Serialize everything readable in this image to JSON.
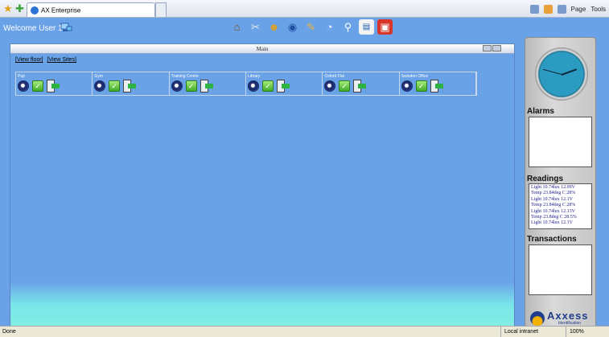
{
  "browser": {
    "tab_title": "AX Enterprise",
    "tools": {
      "page_label": "Page",
      "tools_label": "Tools"
    }
  },
  "app": {
    "welcome": "Welcome User 1",
    "toolbar_icons": [
      "home-icon",
      "tools-icon",
      "users-icon",
      "globe-icon",
      "report-icon",
      "clock-icon",
      "search-icon",
      "card-icon",
      "lock-icon"
    ]
  },
  "main_window": {
    "title": "Main",
    "links": {
      "view_floor": "[View floor]",
      "view_sites": "[View Sites]"
    },
    "sites": [
      {
        "name": "Pop"
      },
      {
        "name": "Gym"
      },
      {
        "name": "Training Centre"
      },
      {
        "name": "Library"
      },
      {
        "name": "Oxford Flat"
      },
      {
        "name": "Swindon Office"
      }
    ]
  },
  "side_panel": {
    "alarms_title": "Alarms",
    "readings_title": "Readings",
    "readings": [
      "Light 10.74lux 12.09V",
      "Temp 23.84deg C 28%",
      "Light 10.74lux 12.1V",
      "Temp 23.84deg C 28%",
      "Light 10.74lux 12.13V",
      "Temp 23.8deg C 28.5%",
      "Light 10.74lux 12.1V"
    ],
    "transactions_title": "Transactions",
    "logo": {
      "name": "Axxess",
      "tagline": "Identification"
    }
  },
  "status_bar": {
    "status": "Done",
    "zone": "Local intranet",
    "zoom": "100%"
  }
}
